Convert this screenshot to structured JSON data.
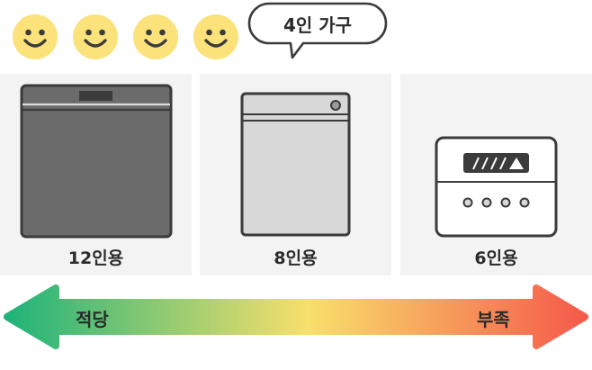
{
  "family": {
    "faces": [
      "smiley-face-icon",
      "smiley-face-icon",
      "smiley-face-icon",
      "smiley-face-icon"
    ],
    "label": "4인 가구"
  },
  "dishwashers": [
    {
      "label": "12인용",
      "icon": "large-dishwasher-icon",
      "color": "#6b6b6b"
    },
    {
      "label": "8인용",
      "icon": "medium-dishwasher-icon",
      "color": "#d8d8d8"
    },
    {
      "label": "6인용",
      "icon": "countertop-dishwasher-icon",
      "color": "#ffffff"
    }
  ],
  "scale": {
    "left_label": "적당",
    "right_label": "부족",
    "gradient": [
      "#1fb37a",
      "#f8e06b",
      "#f5594b"
    ]
  },
  "colors": {
    "face": "#fbe27a",
    "outline": "#3b3b3b",
    "panel_bg": "#f3f3f3"
  }
}
